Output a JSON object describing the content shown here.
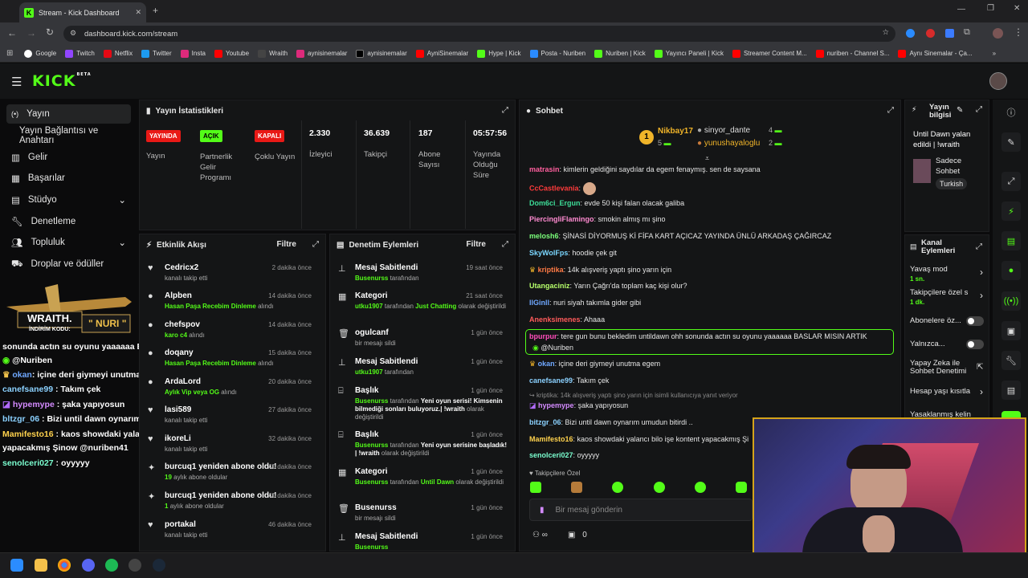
{
  "browser": {
    "tab_title": "Stream - Kick Dashboard",
    "url": "dashboard.kick.com/stream",
    "bookmarks": [
      "Google",
      "Twitch",
      "Netflix",
      "Twitter",
      "Insta",
      "Youtube",
      "Wraith",
      "aynisinemalar",
      "aynisinemalar",
      "AyniSinemalar",
      "Hype | Kick",
      "Posta - Nuriben",
      "Nuriben | Kick",
      "Yayıncı Paneli | Kick",
      "Streamer Content M...",
      "nuriben - Channel S...",
      "Aynı Sinemalar - Ça..."
    ]
  },
  "site": {
    "logo": "KICK",
    "logo_beta": "BETA"
  },
  "sidebar": {
    "items": [
      {
        "label": "Yayın",
        "icon": "live-icon"
      },
      {
        "label": "Yayın Bağlantısı ve Anahtarı",
        "icon": ""
      },
      {
        "label": "Gelir",
        "icon": "revenue-icon"
      },
      {
        "label": "Başarılar",
        "icon": "achievements-icon"
      },
      {
        "label": "Stüdyo",
        "icon": "studio-icon"
      },
      {
        "label": "Denetleme",
        "icon": "wrench-icon"
      },
      {
        "label": "Topluluk",
        "icon": "community-icon"
      },
      {
        "label": "Droplar ve ödüller",
        "icon": "drops-icon"
      }
    ]
  },
  "stats": {
    "title": "Yayın İstatistikleri",
    "badges": [
      {
        "text": "YAYINDA",
        "label": "Yayın",
        "color": "#e91916"
      },
      {
        "text": "AÇIK",
        "label": "Partnerlik Gelir Programı",
        "color": "#53fc18"
      },
      {
        "text": "KAPALI",
        "label": "Çoklu Yayın",
        "color": "#e91916"
      }
    ],
    "values": [
      {
        "value": "2.330",
        "label": "İzleyici"
      },
      {
        "value": "36.639",
        "label": "Takipçi"
      },
      {
        "value": "187",
        "label": "Abone Sayısı"
      },
      {
        "value": "05:57:56",
        "label": "Yayında Olduğu Süre"
      }
    ]
  },
  "activity": {
    "title": "Etkinlik Akışı",
    "filter": "Filtre",
    "items": [
      {
        "name": "Cedricx2",
        "sub": "kanalı takip etti",
        "time": "2 dakika önce",
        "icon": "heart-icon"
      },
      {
        "name": "Alpben",
        "sub_green": "Hasan Paşa Recebim Dinleme",
        "sub_tail": "alındı",
        "time": "14 dakika önce",
        "icon": "gift-icon"
      },
      {
        "name": "chefspov",
        "sub_green": "karo c4",
        "sub_tail": "alındı",
        "time": "14 dakika önce",
        "icon": "gift-icon"
      },
      {
        "name": "doqany",
        "sub_green": "Hasan Paşa Recebim Dinleme",
        "sub_tail": "alındı",
        "time": "15 dakika önce",
        "icon": "gift-icon"
      },
      {
        "name": "ArdaLord",
        "sub_green": "Aylık Vip veya OG",
        "sub_tail": "alındı",
        "time": "20 dakika önce",
        "icon": "gift-icon"
      },
      {
        "name": "lasi589",
        "sub": "kanalı takip etti",
        "time": "27 dakika önce",
        "icon": "heart-icon"
      },
      {
        "name": "ikoreLi",
        "sub": "kanalı takip etti",
        "time": "32 dakika önce",
        "icon": "heart-icon"
      },
      {
        "name": "burcuq1 yeniden abone oldu!",
        "sub_green": "19",
        "sub_tail": "aylık abone oldular",
        "time": "40 dakika önce",
        "icon": "sparkle-icon"
      },
      {
        "name": "burcuq1 yeniden abone oldu!",
        "sub_green": "1",
        "sub_tail": "aylık abone oldular",
        "time": "40 dakika önce",
        "icon": "sparkle-icon"
      },
      {
        "name": "portakal",
        "sub": "kanalı takip etti",
        "time": "46 dakika önce",
        "icon": "heart-icon"
      }
    ]
  },
  "moderation": {
    "title": "Denetim Eylemleri",
    "filter": "Filtre",
    "items": [
      {
        "name": "Mesaj Sabitlendi",
        "time": "19 saat önce",
        "line1_green": "Busenurss",
        "line1_tail": " tarafından",
        "icon": "pin-icon"
      },
      {
        "name": "Kategori",
        "time": "21 saat önce",
        "line1_green": "utku1907",
        "line1_tail": " tarafından ",
        "line1_green2": "Just Chatting",
        "line1_tail2": " olarak değiştirildi",
        "icon": "category-icon"
      },
      {
        "name": "ogulcanf",
        "time": "1 gün önce",
        "line1_tail": "bir mesajı sildi",
        "icon": "trash-icon"
      },
      {
        "name": "Mesaj Sabitlendi",
        "time": "1 gün önce",
        "line1_green": "utku1907",
        "line1_tail": " tarafından",
        "icon": "pin-icon"
      },
      {
        "name": "Başlık",
        "time": "1 gün önce",
        "line1_green": "Busenurss",
        "line1_tail": " tarafından ",
        "line1_white": "Yeni oyun serisi! Kimsenin bilmediği sonları buluyoruz.| !wraith",
        "line1_tail2": " olarak değiştirildi",
        "icon": "title-icon"
      },
      {
        "name": "Başlık",
        "time": "1 gün önce",
        "line1_green": "Busenurss",
        "line1_tail": " tarafından ",
        "line1_white": "Yeni oyun serisine başladık! | !wraith",
        "line1_tail2": " olarak değiştirildi",
        "icon": "title-icon"
      },
      {
        "name": "Kategori",
        "time": "1 gün önce",
        "line1_green": "Busenurss",
        "line1_tail": " tarafından ",
        "line1_green2": "Until Dawn",
        "line1_tail2": " olarak değiştirildi",
        "icon": "category-icon"
      },
      {
        "name": "Busenurss",
        "time": "1 gün önce",
        "line1_tail": "bir mesajı sildi",
        "icon": "trash-icon"
      },
      {
        "name": "Mesaj Sabitlendi",
        "time": "1 gün önce",
        "line1_green": "Busenurss",
        "line1_tail": "",
        "icon": "pin-icon"
      }
    ]
  },
  "chat": {
    "title": "Sohbet",
    "leaders": [
      {
        "rank": "1",
        "name": "Nikbay17",
        "count": "5"
      },
      {
        "name": "sinyor_dante",
        "count": "4"
      },
      {
        "name": "yunushayaloglu",
        "count": "2"
      }
    ],
    "messages": [
      {
        "user": "matrasin",
        "color": "#ff5f9e",
        "text": "kimlerin geldiğini saydılar da egem fenaymış. sen de saysana"
      },
      {
        "user": "CcCastlevania",
        "color": "#ff3b3b",
        "text": ""
      },
      {
        "user": "Dom6ci_Ergun",
        "color": "#3ddc97",
        "text": "evde 50 kişi falan olacak galiba"
      },
      {
        "user": "PiercingliFlamingo",
        "color": "#ff8bd1",
        "text": "smokin almış mı şino"
      },
      {
        "user": "melosh6",
        "color": "#7bff7b",
        "text": "ŞİNASİ DİYORMUŞ Kİ FİFA KART AÇICAZ YAYINDA ÜNLÜ ARKADAŞ ÇAĞIRCAZ"
      },
      {
        "user": "SkyWolFps",
        "color": "#7bd7ff",
        "text": "hoodie çek git"
      },
      {
        "user": "kriptika",
        "color": "#ff7a45",
        "text": "14k alışveriş yaptı şino yarın için"
      },
      {
        "user": "Utangaciniz",
        "color": "#b7ff6b",
        "text": "Yarın Çağrı'da toplam kaç kişi olur?"
      },
      {
        "user": "IlGinll",
        "color": "#6fa8ff",
        "text": "nuri siyah takımla gider gibi"
      },
      {
        "user": "Anenksimenes",
        "color": "#ff5b5b",
        "text": "Ahaaa"
      },
      {
        "user": "bpurpur",
        "color": "#ff4dbb",
        "text": "tere gun bunu bekledim untildawn ohh sonunda actın su oyunu yaaaaaa BASLAR MISIN ARTIK",
        "highlight": true,
        "mention": "@Nuriben"
      },
      {
        "user": "okan",
        "color": "#6fa8ff",
        "text": "içine deri giymeyi unutma egem"
      },
      {
        "user": "canefsane99",
        "color": "#8bd1ff",
        "text": "Takım çek"
      },
      {
        "user": "hypemype",
        "color": "#d48bff",
        "text": "şaka yapıyosun",
        "reply": "kriptika: 14k alışveriş yaptı şino yarın için isimli kullanıcıya yanıt veriyor"
      },
      {
        "user": "bitzgr_06",
        "color": "#8bd1ff",
        "text": "Bizi until dawn oynarım umudun bitirdi .."
      },
      {
        "user": "Mamifesto16",
        "color": "#ffd24d",
        "text": "kaos showdaki yalancı bilo işe kontent yapacakmış Şi"
      },
      {
        "user": "senolceri027",
        "color": "#7bffd0",
        "text": "oyyyyy"
      }
    ],
    "followers_only": "Takipçilere Özel",
    "input_placeholder": "Bir mesaj gönderin",
    "chat_count": "0"
  },
  "stream_info": {
    "title": "Yayın bilgisi",
    "stream_title": "Until Dawn yalan edildi | !wraith",
    "category": "Sadece Sohbet",
    "language": "Turkish"
  },
  "channel_actions": {
    "title": "Kanal Eylemleri",
    "items": [
      {
        "label": "Yavaş mod",
        "value": "1 sn."
      },
      {
        "label": "Takipçilere özel s",
        "value": "1 dk."
      },
      {
        "label": "Abonelere öz...",
        "toggle": true
      },
      {
        "label": "Yalnızca...",
        "toggle": true
      },
      {
        "label": "Yapay Zeka ile Sohbet Denetimi",
        "value": ""
      },
      {
        "label": "Hesap yaşı kısıtla",
        "value": ""
      },
      {
        "label": "Yasaklanmış kelin",
        "value": ""
      }
    ]
  },
  "overlay": {
    "logo": "WRAITH.",
    "code_label": "İNDİRİM KODU:",
    "code": "\" NURI \"",
    "chat": [
      {
        "user": "",
        "color": "#fff",
        "text": "sonunda actın su oyunu yaaaaaa BASLAR MISIN ARTIK"
      },
      {
        "user": "",
        "color": "#fff",
        "text": "@Nuriben"
      },
      {
        "user": "okan",
        "color": "#6fa8ff",
        "text": ": içine deri giymeyi unutma egem"
      },
      {
        "user": "canefsane99",
        "color": "#8bd1ff",
        "text": " : Takım çek"
      },
      {
        "user": "hypemype",
        "color": "#d48bff",
        "text": " : şaka yapıyosun"
      },
      {
        "user": "bltzgr_06",
        "color": "#8bd1ff",
        "text": " : Bizi until dawn oynarım umudun bitirdi .."
      },
      {
        "user": "Mamifesto16",
        "color": "#ffd24d",
        "text": " : kaos showdaki yalancı bilo işe kontent"
      },
      {
        "user": "",
        "color": "#fff",
        "text": "yapacakmış Şinow @nuriben41"
      },
      {
        "user": "senolceri027",
        "color": "#7bffd0",
        "text": " : oyyyyy"
      }
    ]
  },
  "colors": {
    "accent": "#53fc18",
    "live": "#e91916",
    "panel": "#141516"
  }
}
